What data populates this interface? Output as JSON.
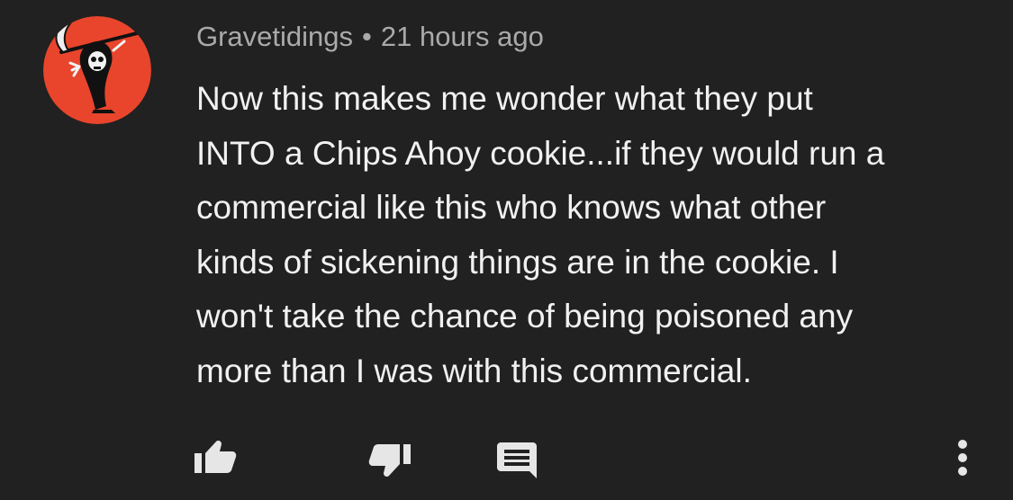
{
  "comment": {
    "author": "Gravetidings",
    "separator": "•",
    "timestamp": "21 hours ago",
    "text_lines": [
      "Now this makes me wonder what they put",
      "INTO a Chips Ahoy cookie...if they would run a",
      "commercial like this who knows what other",
      "kinds of sickening things are in the cookie. I",
      "won't take the chance of being poisoned any",
      "more than I was with this commercial."
    ]
  },
  "avatar": {
    "icon": "grim-reaper-avatar-icon",
    "background_color": "#e8452c"
  },
  "actions": {
    "like_icon": "thumbs-up-icon",
    "dislike_icon": "thumbs-down-icon",
    "reply_icon": "comment-reply-icon",
    "more_icon": "more-vertical-icon"
  },
  "colors": {
    "background": "#212121",
    "text": "#f1f1f1",
    "meta_text": "#aaaaaa",
    "icon": "#e6e6e6"
  }
}
